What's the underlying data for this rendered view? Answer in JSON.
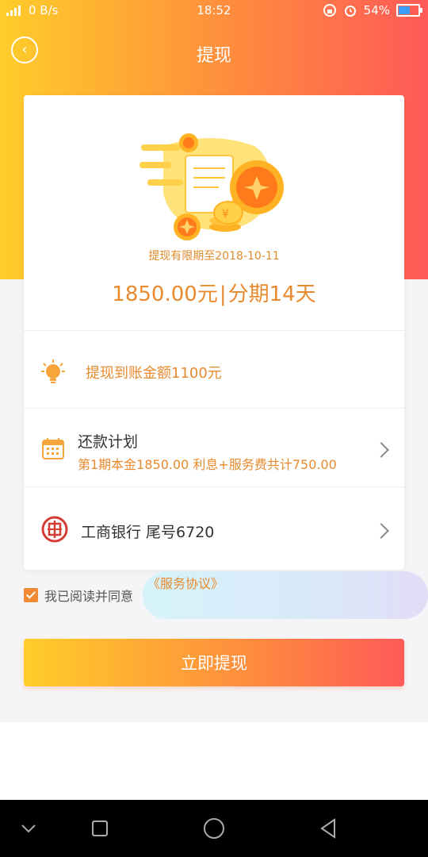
{
  "status_bar": {
    "network_speed": "0 B/s",
    "network_type": "4G",
    "time": "18:52",
    "battery": "54%"
  },
  "header": {
    "title": "提现"
  },
  "card": {
    "limit_date": "提现有限期至2018-10-11",
    "amount": "1850.00元",
    "separator": "|",
    "term": "分期14天"
  },
  "rows": {
    "credit": "提现到账金额1100元",
    "plan_title": "还款计划",
    "plan_detail": "第1期本金1850.00  利息+服务费共计750.00",
    "bank": "工商银行 尾号6720"
  },
  "agreement": {
    "prefix": "我已阅读并同意",
    "link": "《服务协议》",
    "checked": true
  },
  "cta": {
    "label": "立即提现"
  },
  "colors": {
    "accent_orange": "#e88a2e",
    "gradient_start": "#ffcd2a",
    "gradient_end": "#ff5a58"
  }
}
